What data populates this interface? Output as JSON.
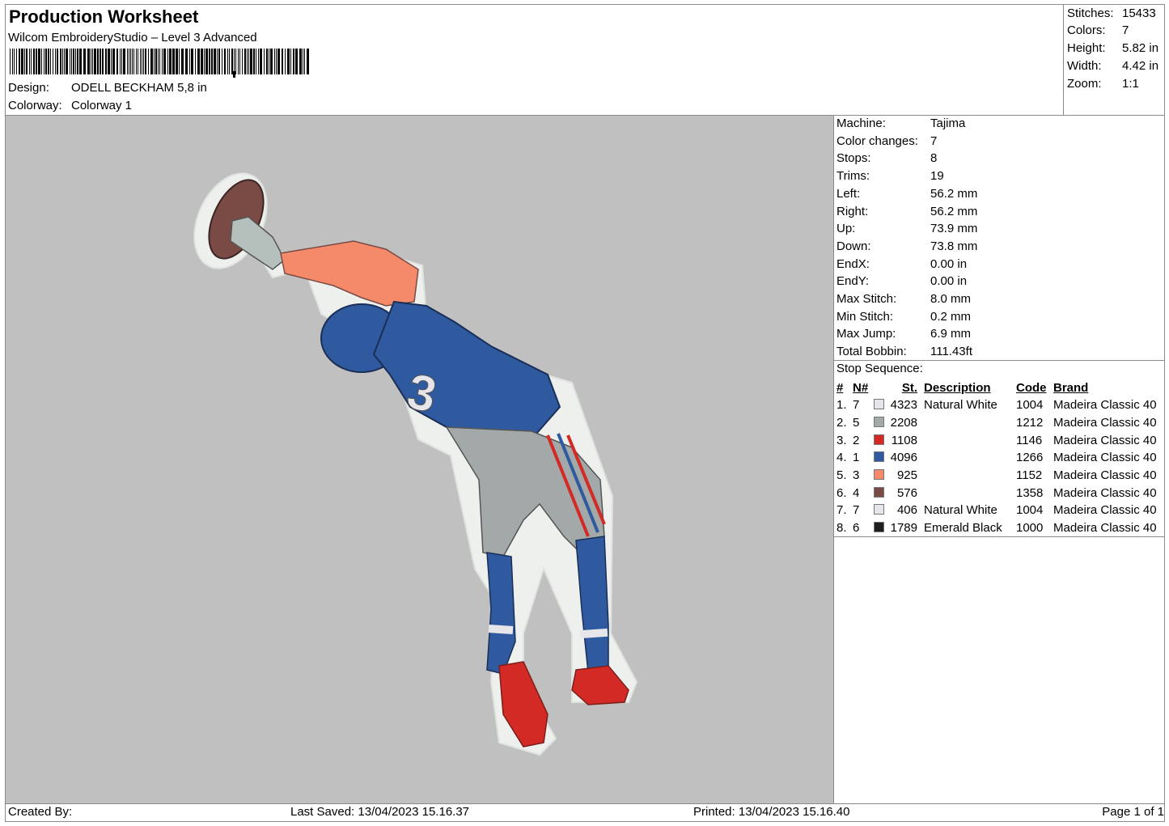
{
  "header": {
    "title": "Production Worksheet",
    "software": "Wilcom EmbroideryStudio – Level 3 Advanced",
    "design_label": "Design:",
    "design_value": "ODELL BECKHAM 5,8 in",
    "colorway_label": "Colorway:",
    "colorway_value": "Colorway 1"
  },
  "summary": [
    {
      "label": "Stitches:",
      "value": "15433"
    },
    {
      "label": "Colors:",
      "value": "7"
    },
    {
      "label": "Height:",
      "value": "5.82 in"
    },
    {
      "label": "Width:",
      "value": "4.42 in"
    },
    {
      "label": "Zoom:",
      "value": "1:1"
    }
  ],
  "machine_info": [
    {
      "label": "Machine:",
      "value": "Tajima"
    },
    {
      "label": "Color changes:",
      "value": "7"
    },
    {
      "label": "Stops:",
      "value": "8"
    },
    {
      "label": "Trims:",
      "value": "19"
    },
    {
      "label": "Left:",
      "value": "56.2 mm"
    },
    {
      "label": "Right:",
      "value": "56.2 mm"
    },
    {
      "label": "Up:",
      "value": "73.9 mm"
    },
    {
      "label": "Down:",
      "value": "73.8 mm"
    },
    {
      "label": "EndX:",
      "value": "0.00 in"
    },
    {
      "label": "EndY:",
      "value": "0.00 in"
    },
    {
      "label": "Max Stitch:",
      "value": "8.0 mm"
    },
    {
      "label": "Min Stitch:",
      "value": "0.2 mm"
    },
    {
      "label": "Max Jump:",
      "value": "6.9 mm"
    },
    {
      "label": "Total Bobbin:",
      "value": "111.43ft"
    }
  ],
  "stop_sequence": {
    "title": "Stop Sequence:",
    "headers": {
      "num": "#",
      "n": "N#",
      "st": "St.",
      "desc": "Description",
      "code": "Code",
      "brand": "Brand"
    },
    "rows": [
      {
        "num": "1.",
        "n": "7",
        "color": "#e6e6ea",
        "st": "4323",
        "desc": "Natural White",
        "code": "1004",
        "brand": "Madeira Classic 40"
      },
      {
        "num": "2.",
        "n": "5",
        "color": "#a2a9a8",
        "st": "2208",
        "desc": "",
        "code": "1212",
        "brand": "Madeira Classic 40"
      },
      {
        "num": "3.",
        "n": "2",
        "color": "#d42a26",
        "st": "1108",
        "desc": "",
        "code": "1146",
        "brand": "Madeira Classic 40"
      },
      {
        "num": "4.",
        "n": "1",
        "color": "#2f5aa0",
        "st": "4096",
        "desc": "",
        "code": "1266",
        "brand": "Madeira Classic 40"
      },
      {
        "num": "5.",
        "n": "3",
        "color": "#f58a6a",
        "st": "925",
        "desc": "",
        "code": "1152",
        "brand": "Madeira Classic 40"
      },
      {
        "num": "6.",
        "n": "4",
        "color": "#7a4a44",
        "st": "576",
        "desc": "",
        "code": "1358",
        "brand": "Madeira Classic 40"
      },
      {
        "num": "7.",
        "n": "7",
        "color": "#e6e6ea",
        "st": "406",
        "desc": "Natural White",
        "code": "1004",
        "brand": "Madeira Classic 40"
      },
      {
        "num": "8.",
        "n": "6",
        "color": "#1e1e1e",
        "st": "1789",
        "desc": "Emerald Black",
        "code": "1000",
        "brand": "Madeira Classic 40"
      }
    ]
  },
  "footer": {
    "created_by": "Created By:",
    "last_saved": "Last Saved: 13/04/2023 15.16.37",
    "printed": "Printed: 13/04/2023 15.16.40",
    "page": "Page 1 of 1"
  },
  "colors": {
    "canvas": "#c0c0c0",
    "border": "#8a8a8a"
  }
}
